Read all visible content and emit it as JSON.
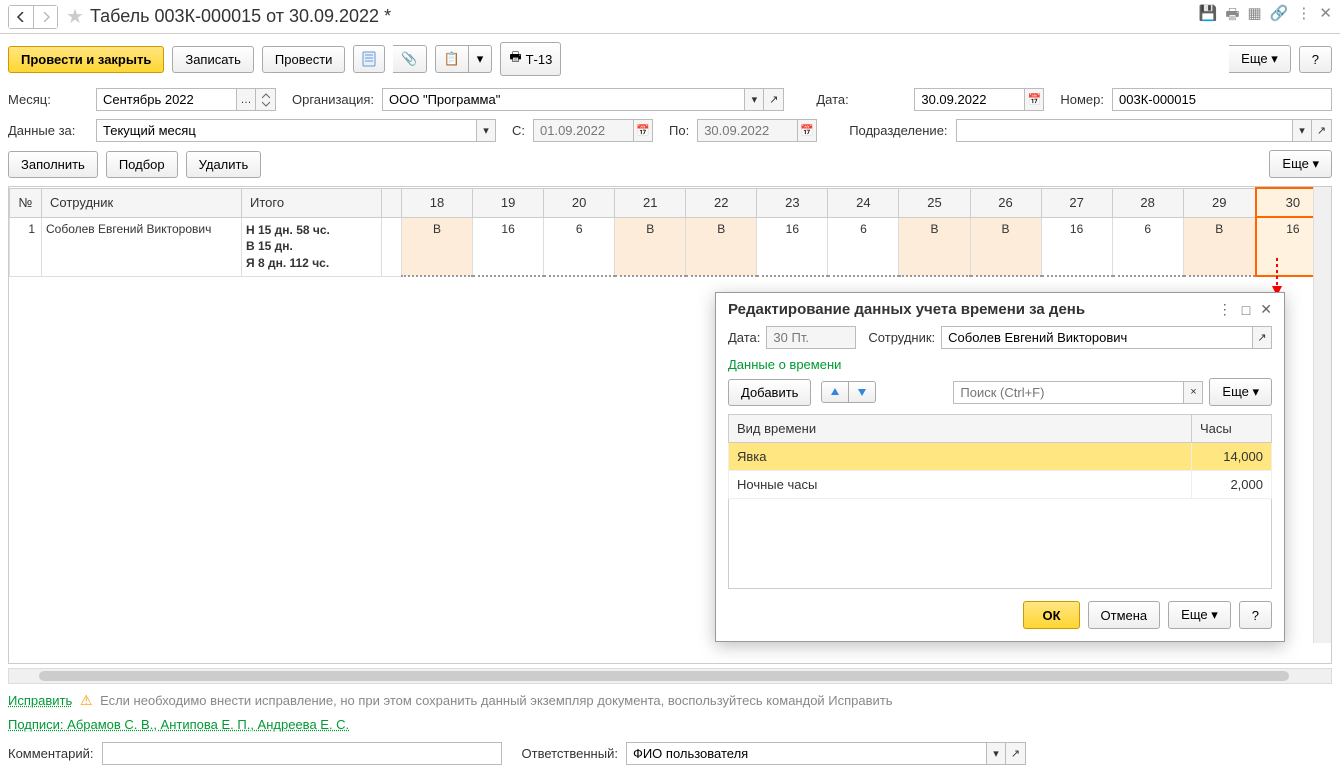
{
  "title": "Табель 003К-000015 от 30.09.2022 *",
  "toolbar": {
    "post_close": "Провести и закрыть",
    "save": "Записать",
    "post": "Провести",
    "t13": "Т-13",
    "more": "Еще",
    "help": "?"
  },
  "form": {
    "month_label": "Месяц:",
    "month_value": "Сентябрь 2022",
    "org_label": "Организация:",
    "org_value": "ООО \"Программа\"",
    "date_label": "Дата:",
    "date_value": "30.09.2022",
    "number_label": "Номер:",
    "number_value": "003К-000015",
    "data_for_label": "Данные за:",
    "data_for_value": "Текущий месяц",
    "from_label": "С:",
    "from_value": "01.09.2022",
    "to_label": "По:",
    "to_value": "30.09.2022",
    "dept_label": "Подразделение:"
  },
  "subtool": {
    "fill": "Заполнить",
    "pick": "Подбор",
    "del": "Удалить",
    "more": "Еще"
  },
  "table": {
    "col_num": "№",
    "col_emp": "Сотрудник",
    "col_total": "Итого",
    "days": [
      "18",
      "19",
      "20",
      "21",
      "22",
      "23",
      "24",
      "25",
      "26",
      "27",
      "28",
      "29",
      "30"
    ],
    "rows": [
      {
        "num": "1",
        "emp": "Соболев Евгений Викторович",
        "total": [
          "Н 15 дн. 58 чс.",
          "В 15 дн.",
          "Я 8 дн. 112 чс."
        ],
        "cells": [
          "В",
          "16",
          "6",
          "В",
          "В",
          "16",
          "6",
          "В",
          "В",
          "16",
          "6",
          "В",
          "16"
        ]
      }
    ]
  },
  "hint": {
    "fix": "Исправить",
    "text": "Если необходимо внести исправление, но при этом сохранить данный экземпляр документа, воспользуйтесь командой Исправить"
  },
  "signs": {
    "label": "Подписи: Абрамов С. В., Антипова Е. П., Андреева Е. С."
  },
  "bottom": {
    "comment_label": "Комментарий:",
    "resp_label": "Ответственный:",
    "resp_value": "ФИО пользователя"
  },
  "dialog": {
    "title": "Редактирование данных учета времени за день",
    "date_label": "Дата:",
    "date_value": "30 Пт.",
    "emp_label": "Сотрудник:",
    "emp_value": "Соболев Евгений Викторович",
    "section": "Данные о времени",
    "add": "Добавить",
    "search_placeholder": "Поиск (Ctrl+F)",
    "more": "Еще",
    "col_type": "Вид времени",
    "col_hours": "Часы",
    "rows": [
      {
        "type": "Явка",
        "hours": "14,000"
      },
      {
        "type": "Ночные часы",
        "hours": "2,000"
      }
    ],
    "ok": "ОК",
    "cancel": "Отмена",
    "help": "?"
  }
}
